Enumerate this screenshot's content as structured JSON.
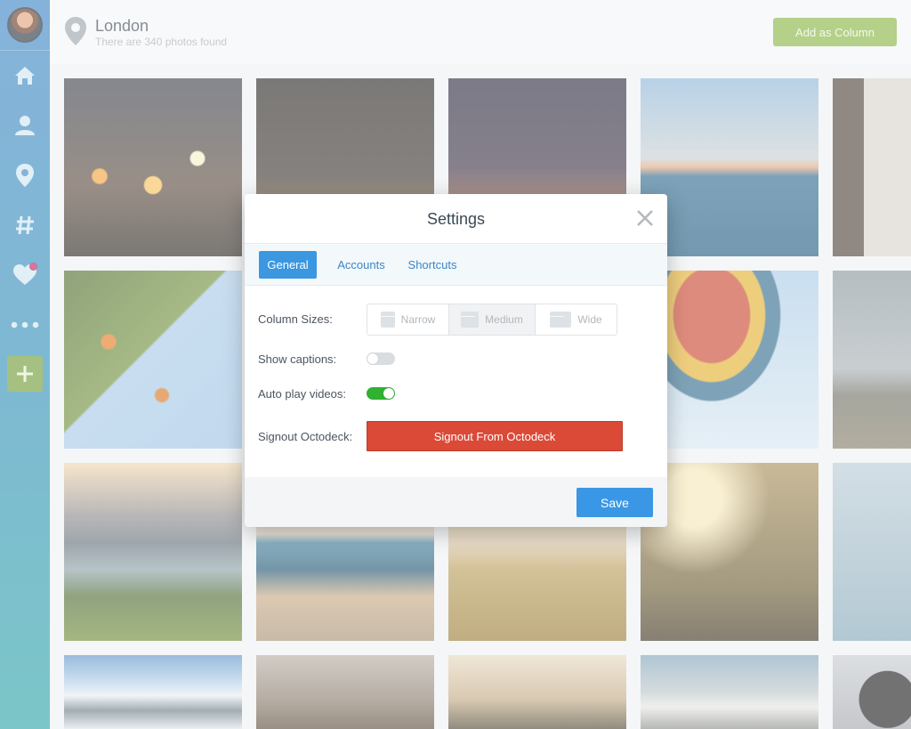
{
  "header": {
    "location_title": "London",
    "location_subtitle": "There are 340 photos found",
    "add_column_label": "Add as Column"
  },
  "sidebar": {
    "items": [
      {
        "name": "home-icon"
      },
      {
        "name": "user-icon"
      },
      {
        "name": "location-pin-icon"
      },
      {
        "name": "hashtag-icon"
      },
      {
        "name": "heart-icon",
        "badge": true
      },
      {
        "name": "more-icon"
      },
      {
        "name": "add-icon"
      }
    ],
    "accent": "#3b84c4",
    "add_button_color": "#6f9a33"
  },
  "modal": {
    "title": "Settings",
    "tabs": [
      {
        "label": "General",
        "active": true
      },
      {
        "label": "Accounts",
        "active": false
      },
      {
        "label": "Shortcuts",
        "active": false
      }
    ],
    "column_sizes": {
      "label": "Column Sizes:",
      "options": [
        "Narrow",
        "Medium",
        "Wide"
      ],
      "selected": "Medium"
    },
    "show_captions": {
      "label": "Show captions:",
      "on": false
    },
    "auto_play": {
      "label": "Auto play videos:",
      "on": true
    },
    "signout": {
      "label": "Signout Octodeck:",
      "button": "Signout From Octodeck"
    },
    "save_label": "Save"
  },
  "colors": {
    "primary": "#3a97e6",
    "danger": "#db4a37",
    "toggle_on": "#30b130",
    "add_column": "#87b442"
  }
}
